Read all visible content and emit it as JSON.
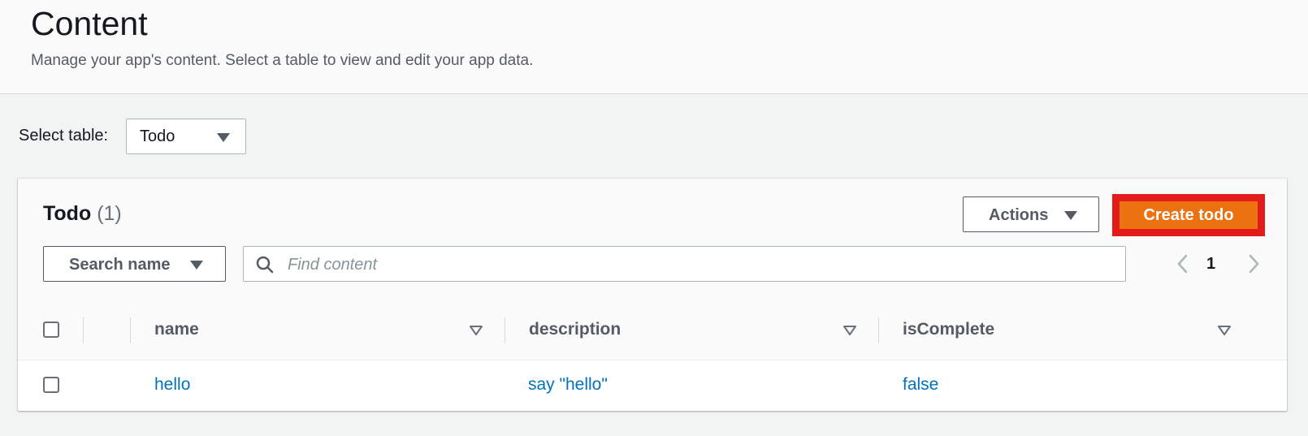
{
  "header": {
    "title": "Content",
    "subtitle": "Manage your app's content. Select a table to view and edit your app data."
  },
  "table_select": {
    "label": "Select table:",
    "value": "Todo"
  },
  "panel": {
    "title": "Todo",
    "count": "(1)",
    "actions_label": "Actions",
    "create_label": "Create todo",
    "search_by_label": "Search name",
    "search_placeholder": "Find content",
    "search_value": "",
    "page": "1"
  },
  "columns": [
    {
      "label": "name"
    },
    {
      "label": "description"
    },
    {
      "label": "isComplete"
    }
  ],
  "rows": [
    {
      "name": "hello",
      "description": "say \"hello\"",
      "isComplete": "false"
    }
  ],
  "icons": {
    "dropdown": "caret-down-icon",
    "search": "search-icon",
    "sort": "sort-triangle-icon",
    "prev": "chevron-left-icon",
    "next": "chevron-right-icon"
  },
  "colors": {
    "primary_button": "#ec7211",
    "highlight_border": "#e21b1b",
    "link": "#0073bb"
  }
}
